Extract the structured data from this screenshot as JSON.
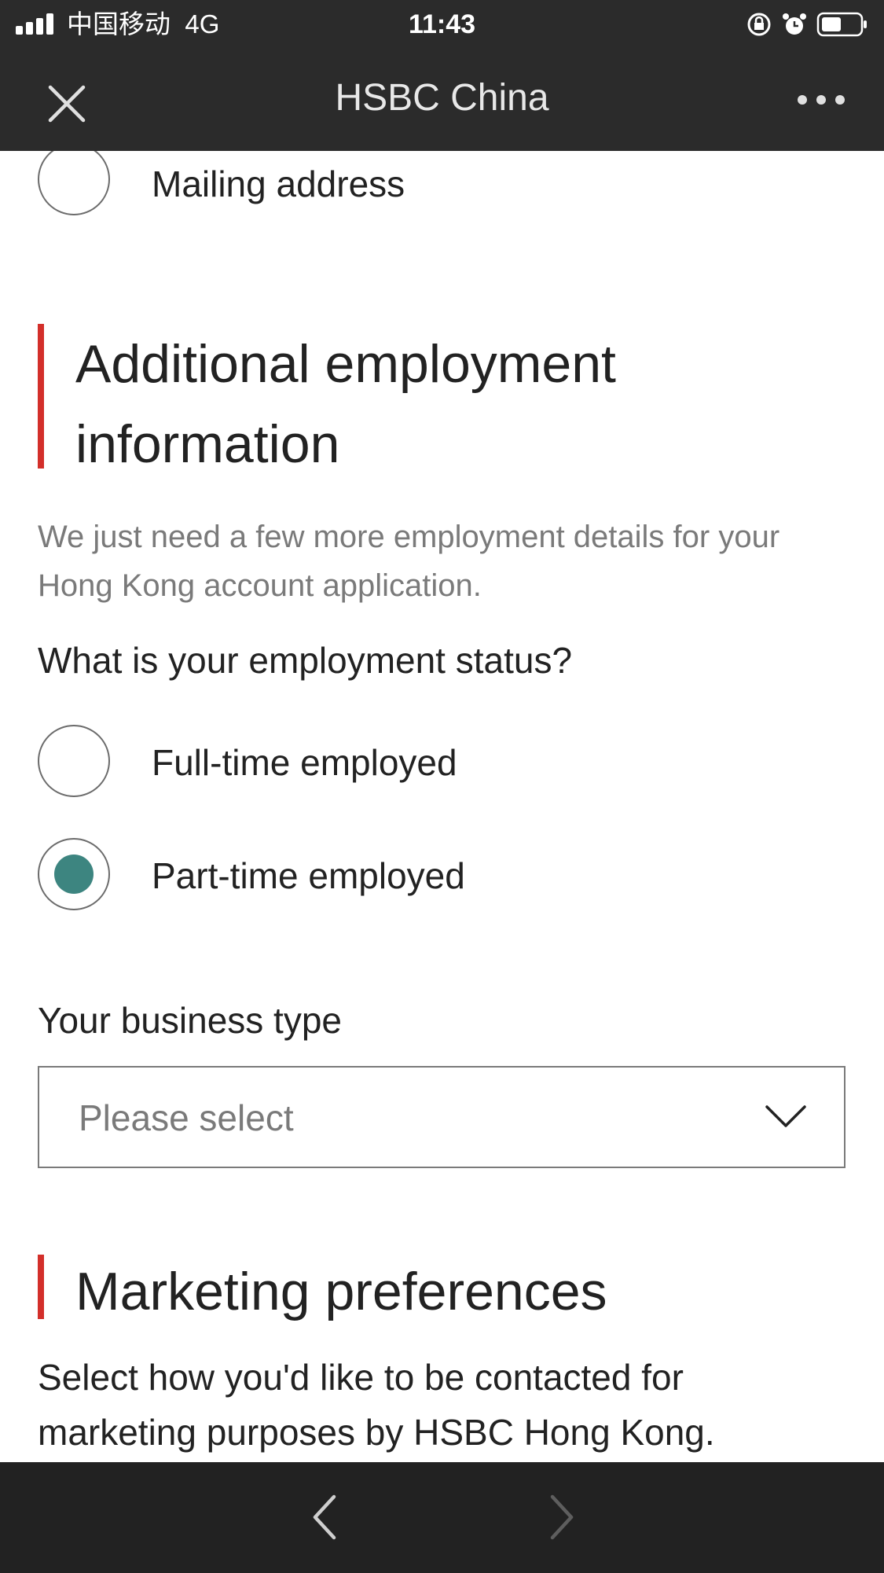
{
  "status_bar": {
    "carrier": "中国移动",
    "network": "4G",
    "time": "11:43",
    "icons": [
      "signal-icon",
      "orientation-lock-icon",
      "alarm-icon",
      "battery-icon"
    ]
  },
  "nav": {
    "title": "HSBC China",
    "close_icon": "close-icon",
    "more_icon": "more-icon"
  },
  "address": {
    "mailing_label": "Mailing address",
    "selected": false
  },
  "employment": {
    "heading": "Additional employment information",
    "intro": "We just need a few more employment details for your Hong Kong account application.",
    "question": "What is your employment status?",
    "options": [
      {
        "label": "Full-time employed",
        "selected": false
      },
      {
        "label": "Part-time employed",
        "selected": true
      }
    ],
    "business_type_label": "Your business type",
    "business_type_placeholder": "Please select"
  },
  "marketing": {
    "heading": "Marketing preferences",
    "text": "Select how you'd like to be contacted for marketing purposes by HSBC Hong Kong."
  },
  "toolbar": {
    "back_icon": "chevron-left-icon",
    "forward_icon": "chevron-right-icon"
  },
  "colors": {
    "header_bg": "#2b2b2b",
    "accent_red": "#d32f2a",
    "radio_selected": "#3d8580",
    "muted_text": "#7a7a7a",
    "bottom_bar_bg": "#222222"
  }
}
